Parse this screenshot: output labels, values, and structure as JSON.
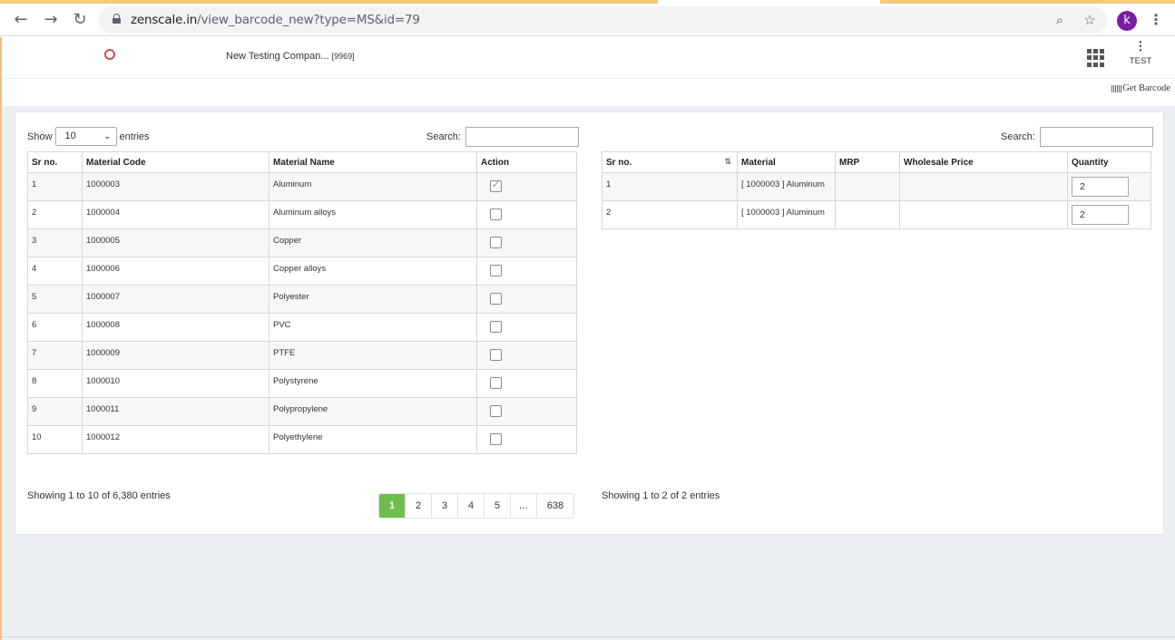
{
  "browser": {
    "url_host": "zenscale.in",
    "url_path": "/view_barcode_new?type=MS&id=79",
    "avatar_letter": "k",
    "icons": [
      "back-icon",
      "forward-icon",
      "reload-icon",
      "lock-icon",
      "zoom-icon",
      "star-icon",
      "menu-icon"
    ]
  },
  "header": {
    "company_name": "New Testing Compan...",
    "company_id": "[9969]",
    "user_label": "TEST",
    "get_barcode": "Get Barcode"
  },
  "left_panel": {
    "show_label": "Show",
    "entries_value": "10",
    "entries_label": "entries",
    "search_label": "Search:",
    "columns": [
      "Sr no.",
      "Material Code",
      "Material Name",
      "Action"
    ],
    "rows": [
      {
        "sr": "1",
        "code": "1000003",
        "name": "Aluminum",
        "checked": true
      },
      {
        "sr": "2",
        "code": "1000004",
        "name": "Aluminum alloys",
        "checked": false
      },
      {
        "sr": "3",
        "code": "1000005",
        "name": "Copper",
        "checked": false
      },
      {
        "sr": "4",
        "code": "1000006",
        "name": "Copper alloys",
        "checked": false
      },
      {
        "sr": "5",
        "code": "1000007",
        "name": "Polyester",
        "checked": false
      },
      {
        "sr": "6",
        "code": "1000008",
        "name": "PVC",
        "checked": false
      },
      {
        "sr": "7",
        "code": "1000009",
        "name": "PTFE",
        "checked": false
      },
      {
        "sr": "8",
        "code": "1000010",
        "name": "Polystyrene",
        "checked": false
      },
      {
        "sr": "9",
        "code": "1000011",
        "name": "Polypropylene",
        "checked": false
      },
      {
        "sr": "10",
        "code": "1000012",
        "name": "Polyethylene",
        "checked": false
      }
    ],
    "info": "Showing 1 to 10 of 6,380 entries",
    "pages": [
      "1",
      "2",
      "3",
      "4",
      "5",
      "…",
      "638"
    ],
    "active_page": "1"
  },
  "right_panel": {
    "search_label": "Search:",
    "columns": [
      "Sr no.",
      "Material",
      "MRP",
      "Wholesale Price",
      "Quantity"
    ],
    "rows": [
      {
        "sr": "1",
        "material": "[ 1000003 ] Aluminum",
        "mrp": "",
        "wholesale": "",
        "quantity": "2"
      },
      {
        "sr": "2",
        "material": "[ 1000003 ] Aluminum",
        "mrp": "",
        "wholesale": "",
        "quantity": "2"
      }
    ],
    "info": "Showing 1 to 2 of 2 entries"
  },
  "colors": {
    "accent_green": "#6cc04a",
    "avatar_purple": "#7b1fa2",
    "tab_orange": "#f6c97a"
  }
}
